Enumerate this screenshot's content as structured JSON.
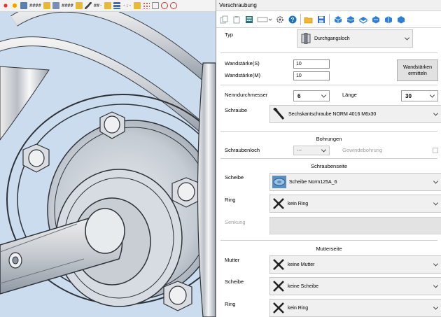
{
  "cad": {
    "toolbar_texts": [
      "####",
      "####",
      "##-",
      "-:-"
    ]
  },
  "panel": {
    "title": "Verschraubung",
    "typ": {
      "label": "Typ",
      "value": "Durchgangsloch"
    },
    "wandstaerke_s": {
      "label": "Wandstärke(S)",
      "value": "10"
    },
    "wandstaerke_m": {
      "label": "Wandstärke(M)",
      "value": "10"
    },
    "wandstaerken_button": "Wandstärken ermitteln",
    "nenndurchmesser": {
      "label": "Nenndurchmesser",
      "value": "6"
    },
    "laenge": {
      "label": "Länge",
      "value": "30"
    },
    "schraube": {
      "label": "Schraube",
      "value": "Sechskantschraube NORM 4016 M6x30"
    },
    "bohrungen": {
      "title": "Bohrungen",
      "schraubenloch_label": "Schraubenloch",
      "schraubenloch_value": "---",
      "gewindebohrung_label": "Gewindebohrung"
    },
    "schraubenseite": {
      "title": "Schraubenseite",
      "scheibe": {
        "label": "Scheibe",
        "value": "Scheibe Norm125A_6"
      },
      "ring": {
        "label": "Ring",
        "value": "kein Ring"
      },
      "senkung": {
        "label": "Senkung"
      }
    },
    "mutterseite": {
      "title": "Mutterseite",
      "mutter": {
        "label": "Mutter",
        "value": "keine Mutter"
      },
      "scheibe": {
        "label": "Scheibe",
        "value": "keine Scheibe"
      },
      "ring": {
        "label": "Ring",
        "value": "kein Ring"
      }
    }
  },
  "colors": {
    "accent_blue": "#1e73be",
    "save_blue": "#2f6fd1",
    "folder_yellow": "#f2b630",
    "red_x": "#e02020"
  }
}
